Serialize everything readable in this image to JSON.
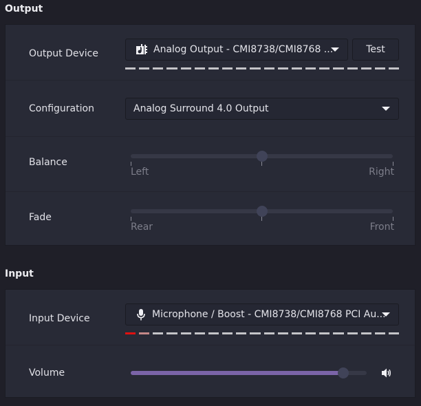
{
  "output": {
    "section_title": "Output",
    "device": {
      "label": "Output Device",
      "icon": "audio-card-icon",
      "value": "Analog Output - CMI8738/CMI8768 ...",
      "test_button": "Test",
      "level_segments_active": 0,
      "level_segments_total": 20
    },
    "configuration": {
      "label": "Configuration",
      "value": "Analog Surround 4.0 Output"
    },
    "balance": {
      "label": "Balance",
      "min_label": "Left",
      "max_label": "Right",
      "value": 0.5
    },
    "fade": {
      "label": "Fade",
      "min_label": "Rear",
      "max_label": "Front",
      "value": 0.5
    }
  },
  "input": {
    "section_title": "Input",
    "device": {
      "label": "Input Device",
      "icon": "microphone-icon",
      "value": "Microphone / Boost - CMI8738/CMI8768 PCI Au...",
      "level_segments_active": 2,
      "level_segments_total": 20
    },
    "volume": {
      "label": "Volume",
      "value": 0.9,
      "icon": "speaker-volume-high-icon"
    }
  },
  "colors": {
    "accent": "#7b64a8",
    "level_peak": "#e01010",
    "level_mid": "#c48888",
    "level_idle": "#c4c4c8"
  }
}
